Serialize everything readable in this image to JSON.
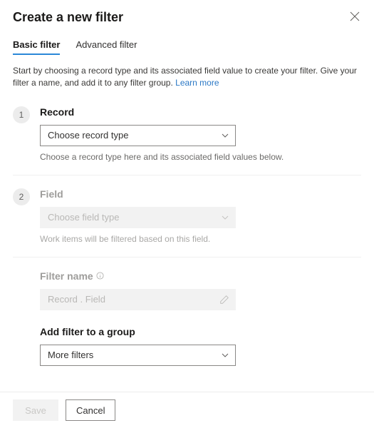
{
  "header": {
    "title": "Create a new filter"
  },
  "tabs": {
    "basic": "Basic filter",
    "advanced": "Advanced filter",
    "active": "basic"
  },
  "intro": {
    "text": "Start by choosing a record type and its associated field value to create your filter. Give your filter a name, and add it to any filter group. ",
    "link_label": "Learn more"
  },
  "steps": {
    "record": {
      "number": "1",
      "label": "Record",
      "placeholder": "Choose record type",
      "helper": "Choose a record type here and its associated field values below."
    },
    "field": {
      "number": "2",
      "label": "Field",
      "placeholder": "Choose field type",
      "helper": "Work items will be filtered based on this field."
    }
  },
  "filter_name": {
    "label": "Filter name",
    "placeholder": "Record . Field",
    "value": ""
  },
  "group": {
    "label": "Add filter to a group",
    "selected": "More filters"
  },
  "footer": {
    "save": "Save",
    "cancel": "Cancel"
  },
  "icons": {
    "close": "close-icon",
    "chevron_down": "chevron-down-icon",
    "info": "info-icon",
    "edit": "pencil-icon"
  }
}
